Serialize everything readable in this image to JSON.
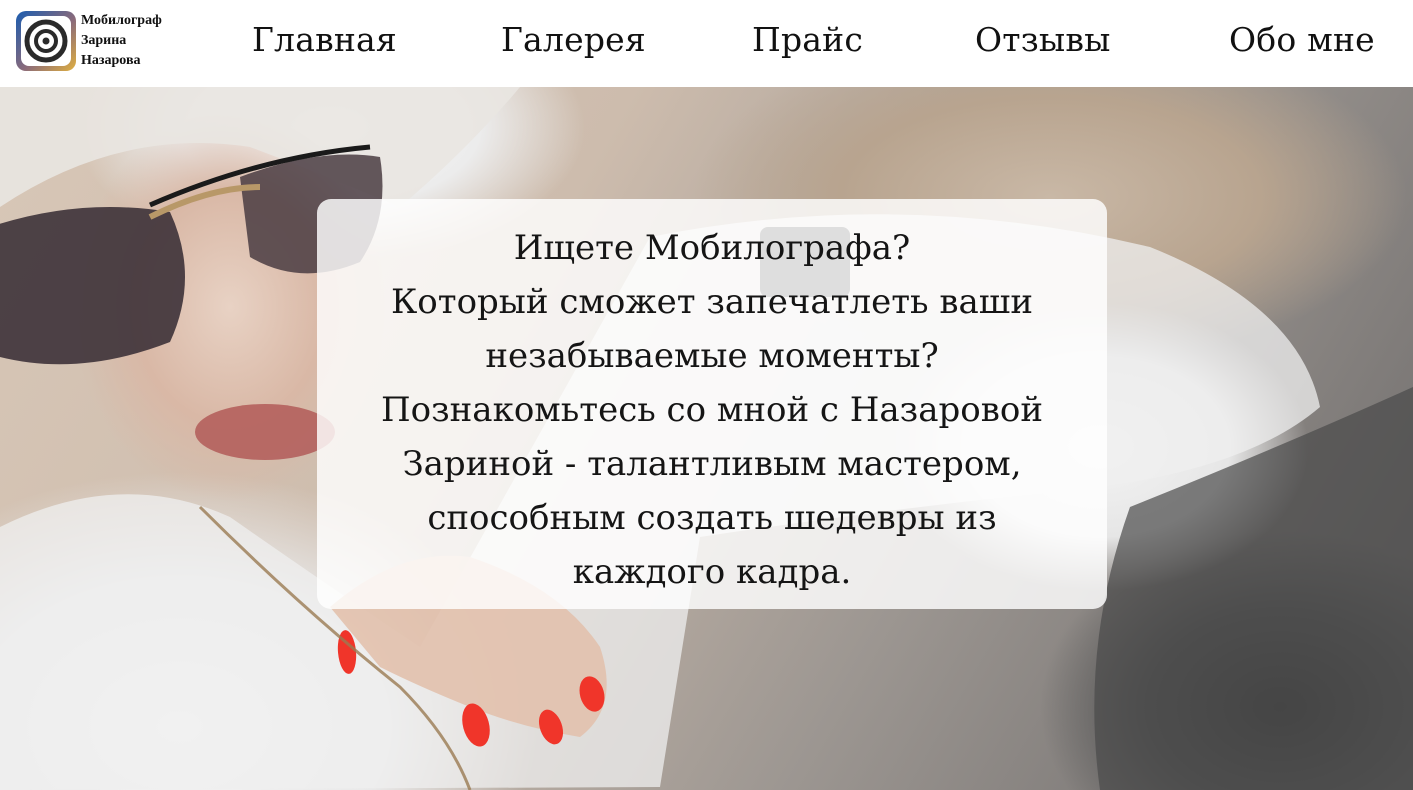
{
  "logo": {
    "name_lines": [
      "Мобилограф",
      "Зарина",
      "Назарова"
    ],
    "icon": "camera-lens-icon",
    "colors": {
      "outer_top_left": "#1a5cb0",
      "outer_bottom_right": "#e0b040",
      "inner": "#2a2a2a"
    }
  },
  "nav": {
    "items": [
      {
        "label": "Главная"
      },
      {
        "label": "Галерея"
      },
      {
        "label": "Прайс"
      },
      {
        "label": "Отзывы"
      },
      {
        "label": "Обо мне"
      }
    ]
  },
  "hero": {
    "text_lines": [
      "Ищете Мобилографа?",
      "Который сможет запечатлеть ваши",
      "незабываемые моменты?",
      "Познакомьтесь со мной с Назаровой",
      "Зариной - талантливым мастером,",
      "способным создать шедевры из",
      "каждого кадра."
    ],
    "background": "photo-woman-in-sunglasses-in-car",
    "accent_nail_color": "#f0352a"
  }
}
